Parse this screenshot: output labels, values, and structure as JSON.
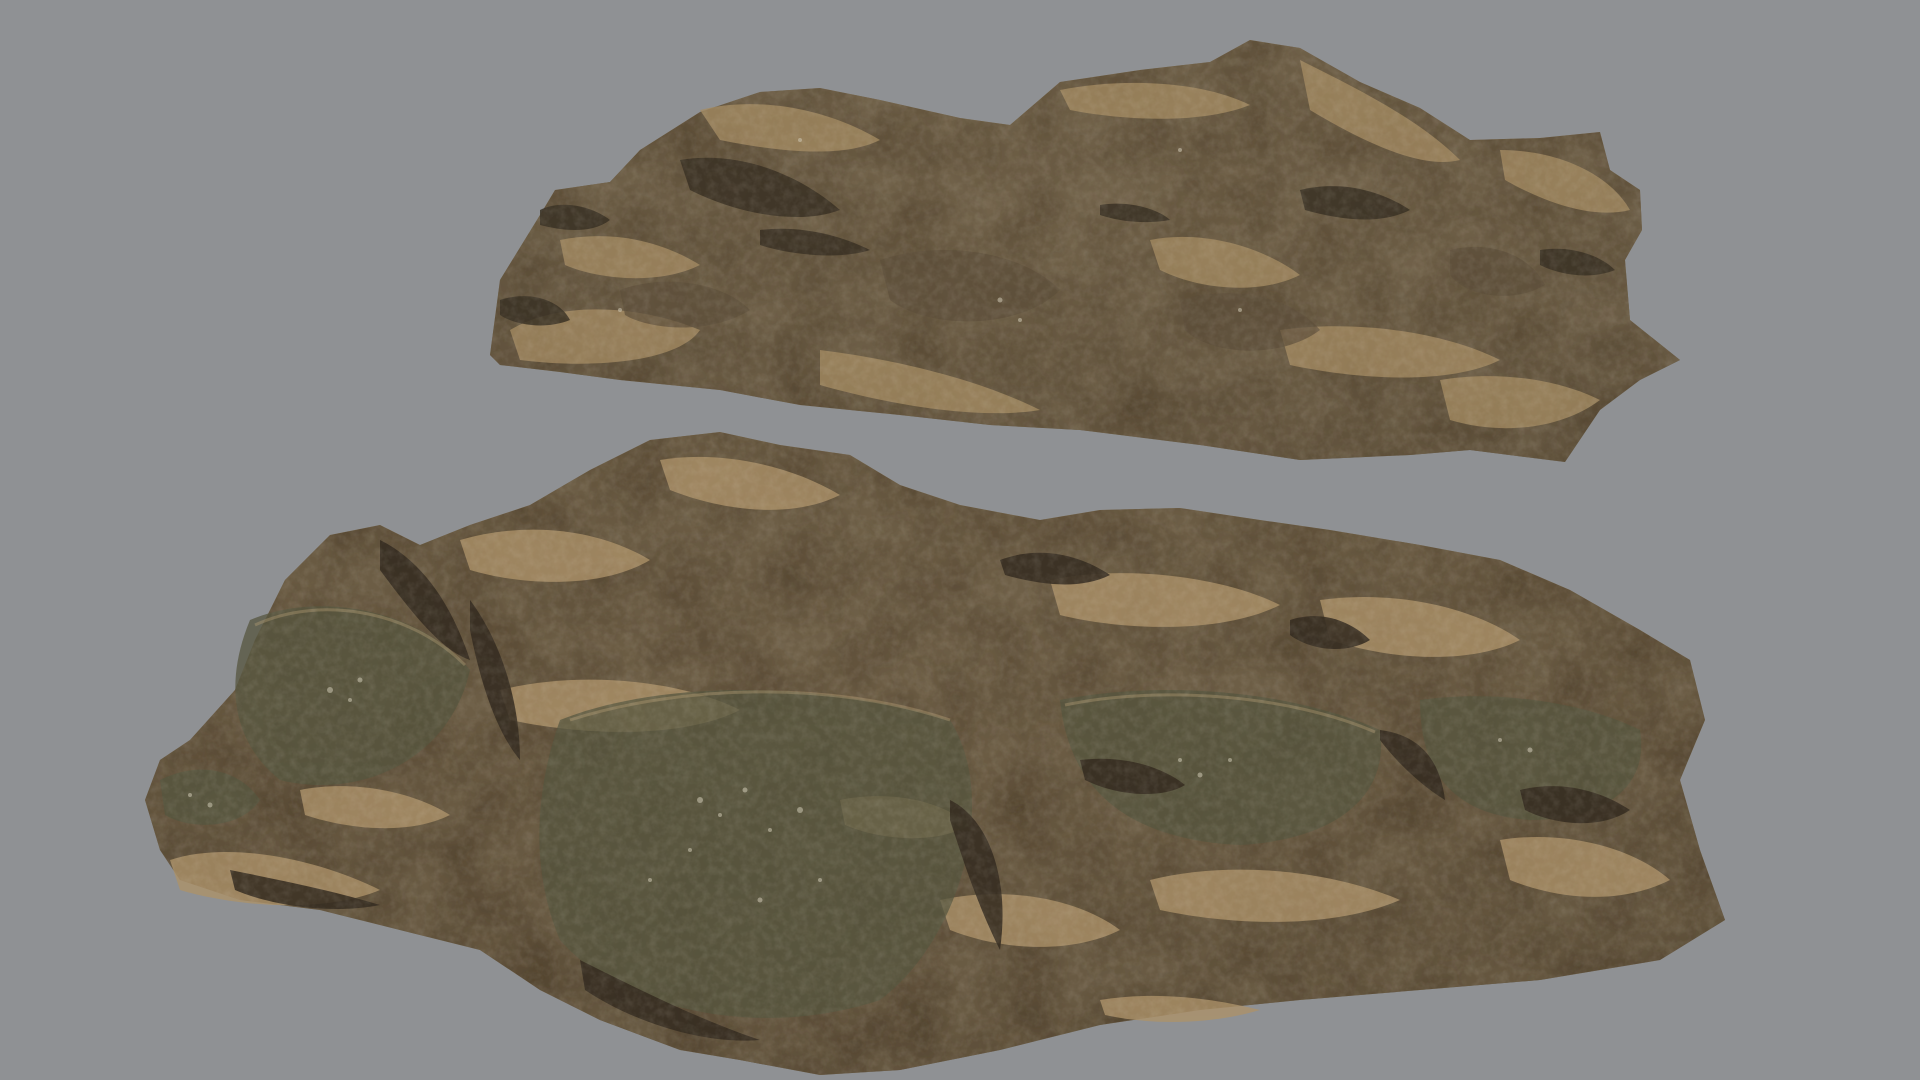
{
  "scene": {
    "background_color": "#8f9194",
    "objects": [
      {
        "id": "rock-upper",
        "name": "rock-formation-upper",
        "base_color": "#6f6048",
        "shadow_color": "#3f3628",
        "highlight_color": "#a98f66",
        "moss_color": "#5b5b45"
      },
      {
        "id": "rock-lower",
        "name": "rock-formation-lower",
        "base_color": "#6c5d45",
        "shadow_color": "#3a3125",
        "highlight_color": "#b09670",
        "moss_color": "#56573f"
      }
    ]
  }
}
